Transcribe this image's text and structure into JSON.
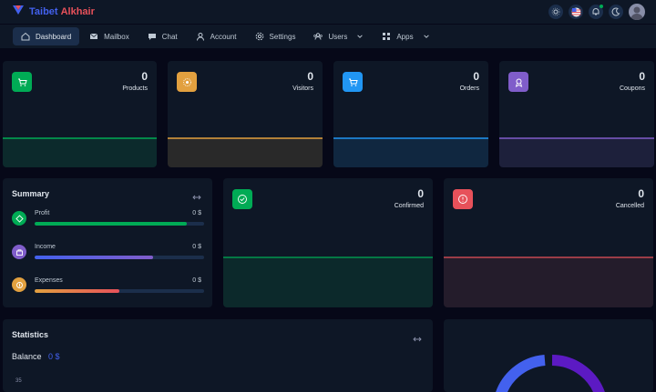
{
  "brand": {
    "name_part1": "Taibet",
    "name_part2": "Alkhair",
    "logo_icon": "v-logo-icon"
  },
  "topbar_icons": [
    "theme-icon",
    "flag-icon",
    "notification-bell-icon",
    "moon-icon",
    "user-avatar"
  ],
  "menu": [
    {
      "label": "Dashboard",
      "icon": "home-icon",
      "active": true
    },
    {
      "label": "Mailbox",
      "icon": "mail-icon"
    },
    {
      "label": "Chat",
      "icon": "chat-icon"
    },
    {
      "label": "Account",
      "icon": "user-icon"
    },
    {
      "label": "Settings",
      "icon": "gear-icon"
    },
    {
      "label": "Users",
      "icon": "users-icon",
      "has_dropdown": true
    },
    {
      "label": "Apps",
      "icon": "apps-icon",
      "has_dropdown": true
    }
  ],
  "stats": [
    {
      "value": "0",
      "label": "Products",
      "color": "#00ab55",
      "icon": "cart-icon"
    },
    {
      "value": "0",
      "label": "Visitors",
      "color": "#e2a03f",
      "icon": "eye-icon"
    },
    {
      "value": "0",
      "label": "Orders",
      "color": "#2196f3",
      "icon": "bag-icon"
    },
    {
      "value": "0",
      "label": "Coupons",
      "color": "#805dca",
      "icon": "ticket-icon"
    }
  ],
  "summary": {
    "title": "Summary",
    "rows": [
      {
        "label": "Profit",
        "value": "0 $",
        "color": "#00ab55",
        "fill": 0.9
      },
      {
        "label": "Income",
        "value": "0 $",
        "color": "#805dca",
        "fill": 0.7
      },
      {
        "label": "Expenses",
        "value": "0 $",
        "color": "#e7515a",
        "fill": 0.5
      }
    ]
  },
  "order_status": [
    {
      "value": "0",
      "label": "Confirmed",
      "color": "#00ab55",
      "icon": "check-icon"
    },
    {
      "value": "0",
      "label": "Cancelled",
      "color": "#e7515a",
      "icon": "cancel-icon"
    }
  ],
  "statistics": {
    "title": "Statistics",
    "balance_label": "Balance",
    "balance_value": "0 $",
    "axis_tick": "35"
  }
}
